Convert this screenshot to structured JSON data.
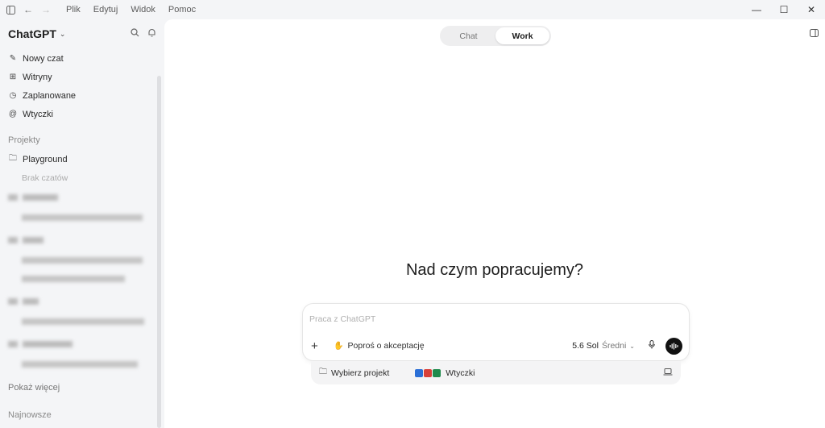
{
  "menu": [
    "Plik",
    "Edytuj",
    "Widok",
    "Pomoc"
  ],
  "sidebar": {
    "brand": "ChatGPT",
    "items": [
      {
        "label": "Nowy czat",
        "icon": "edit-icon"
      },
      {
        "label": "Witryny",
        "icon": "grid-icon"
      },
      {
        "label": "Zaplanowane",
        "icon": "clock-icon"
      },
      {
        "label": "Wtyczki",
        "icon": "at-icon"
      }
    ],
    "projects_heading": "Projekty",
    "project": "Playground",
    "no_chats": "Brak czatów",
    "show_more": "Pokaż więcej",
    "recent_heading": "Najnowsze"
  },
  "tabs": [
    "Chat",
    "Work"
  ],
  "active_tab": "Work",
  "headline": "Nad czym popracujemy?",
  "composer": {
    "placeholder": "Praca z ChatGPT",
    "approval_label": "Poproś o akceptację",
    "model": "5.6 Sol",
    "effort": "Średni"
  },
  "subbar": {
    "project_picker": "Wybierz projekt",
    "plugins_label": "Wtyczki"
  },
  "colors": {
    "sidebar_bg": "#f4f5f7",
    "main_bg": "#ffffff",
    "accent_dark": "#111111"
  }
}
